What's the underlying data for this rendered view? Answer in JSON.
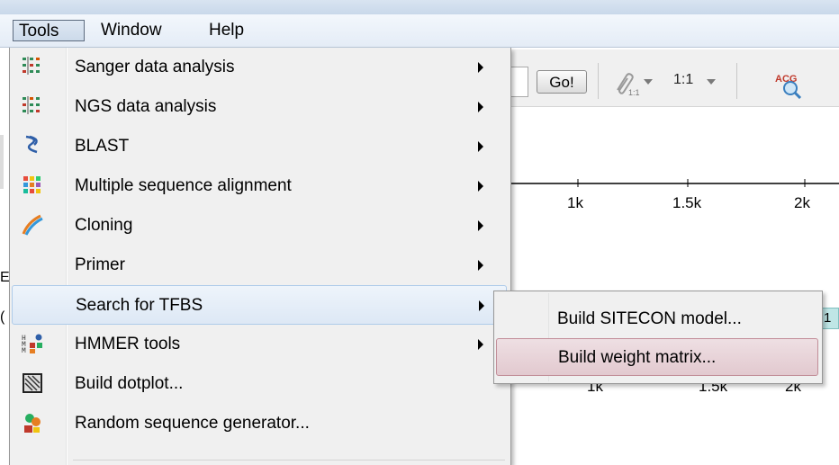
{
  "menubar": {
    "items": [
      {
        "label": "Tools"
      },
      {
        "label": "Window"
      },
      {
        "label": "Help"
      }
    ]
  },
  "toolbar": {
    "go_label": "Go!",
    "zoom_label": "1:1",
    "clip_icon_sub": "1:1",
    "acg_icon_text": "ACG"
  },
  "ruler_top": {
    "ticks": [
      "1k",
      "1.5k",
      "2k"
    ]
  },
  "ruler_bottom": {
    "ticks": [
      "1k",
      "1.5k",
      "2k"
    ]
  },
  "sequence_segment_label": "1",
  "tools_menu": {
    "items": [
      {
        "label": "Sanger data analysis",
        "icon": "sanger-icon",
        "submenu": true
      },
      {
        "label": "NGS data analysis",
        "icon": "ngs-icon",
        "submenu": true
      },
      {
        "label": "BLAST",
        "icon": "blast-icon",
        "submenu": true
      },
      {
        "label": "Multiple sequence alignment",
        "icon": "msa-icon",
        "submenu": true
      },
      {
        "label": "Cloning",
        "icon": "dna-icon",
        "submenu": true
      },
      {
        "label": "Primer",
        "icon": "",
        "submenu": true
      },
      {
        "label": "Search for TFBS",
        "icon": "",
        "submenu": true,
        "highlighted": true
      },
      {
        "label": "HMMER tools",
        "icon": "hmmer-icon",
        "submenu": true
      },
      {
        "label": "Build dotplot...",
        "icon": "dotplot-icon",
        "submenu": false
      },
      {
        "label": "Random sequence generator...",
        "icon": "random-seq-icon",
        "submenu": false
      }
    ]
  },
  "tfbs_submenu": {
    "items": [
      {
        "label": "Build SITECON model..."
      },
      {
        "label": "Build weight matrix...",
        "highlighted": true
      }
    ]
  },
  "colors": {
    "menu_highlight": "#dde8f5",
    "submenu_highlight": "#e2c9cf",
    "menu_background": "#f0f0f0"
  }
}
